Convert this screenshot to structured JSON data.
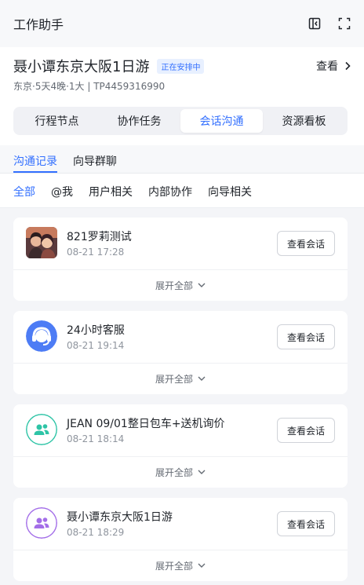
{
  "app": {
    "title": "工作助手"
  },
  "trip": {
    "name": "聂小谭东京大阪1日游",
    "badge": "正在安排中",
    "view_label": "查看",
    "meta": "东京·5天4晚·1大 | TP4459316990"
  },
  "segments": [
    "行程节点",
    "协作任务",
    "会话沟通",
    "资源看板"
  ],
  "active_segment": "会话沟通",
  "subtabs": [
    "沟通记录",
    "向导群聊"
  ],
  "active_subtab": "沟通记录",
  "filters": [
    "全部",
    "@我",
    "用户相关",
    "内部协作",
    "向导相关"
  ],
  "active_filter": "全部",
  "conversations": [
    {
      "name": "821罗莉测试",
      "time": "08-21 17:28",
      "avatar": "photo-avatar",
      "button": "查看会话",
      "expand": "展开全部"
    },
    {
      "name": "24小时客服",
      "time": "08-21 19:14",
      "avatar": "headset-icon",
      "button": "查看会话",
      "expand": "展开全部"
    },
    {
      "name": "JEAN 09/01整日包车+送机询价",
      "time": "08-21 18:14",
      "avatar": "group-icon",
      "button": "查看会话",
      "expand": "展开全部"
    },
    {
      "name": "聂小谭东京大阪1日游",
      "time": "08-21 18:29",
      "avatar": "group-icon",
      "button": "查看会话",
      "expand": "展开全部"
    }
  ],
  "colors": {
    "accent": "#3370ff",
    "service_avatar": "#4d7cf5",
    "group_teal": "#2ec4a6",
    "group_purple": "#a36ee8"
  }
}
